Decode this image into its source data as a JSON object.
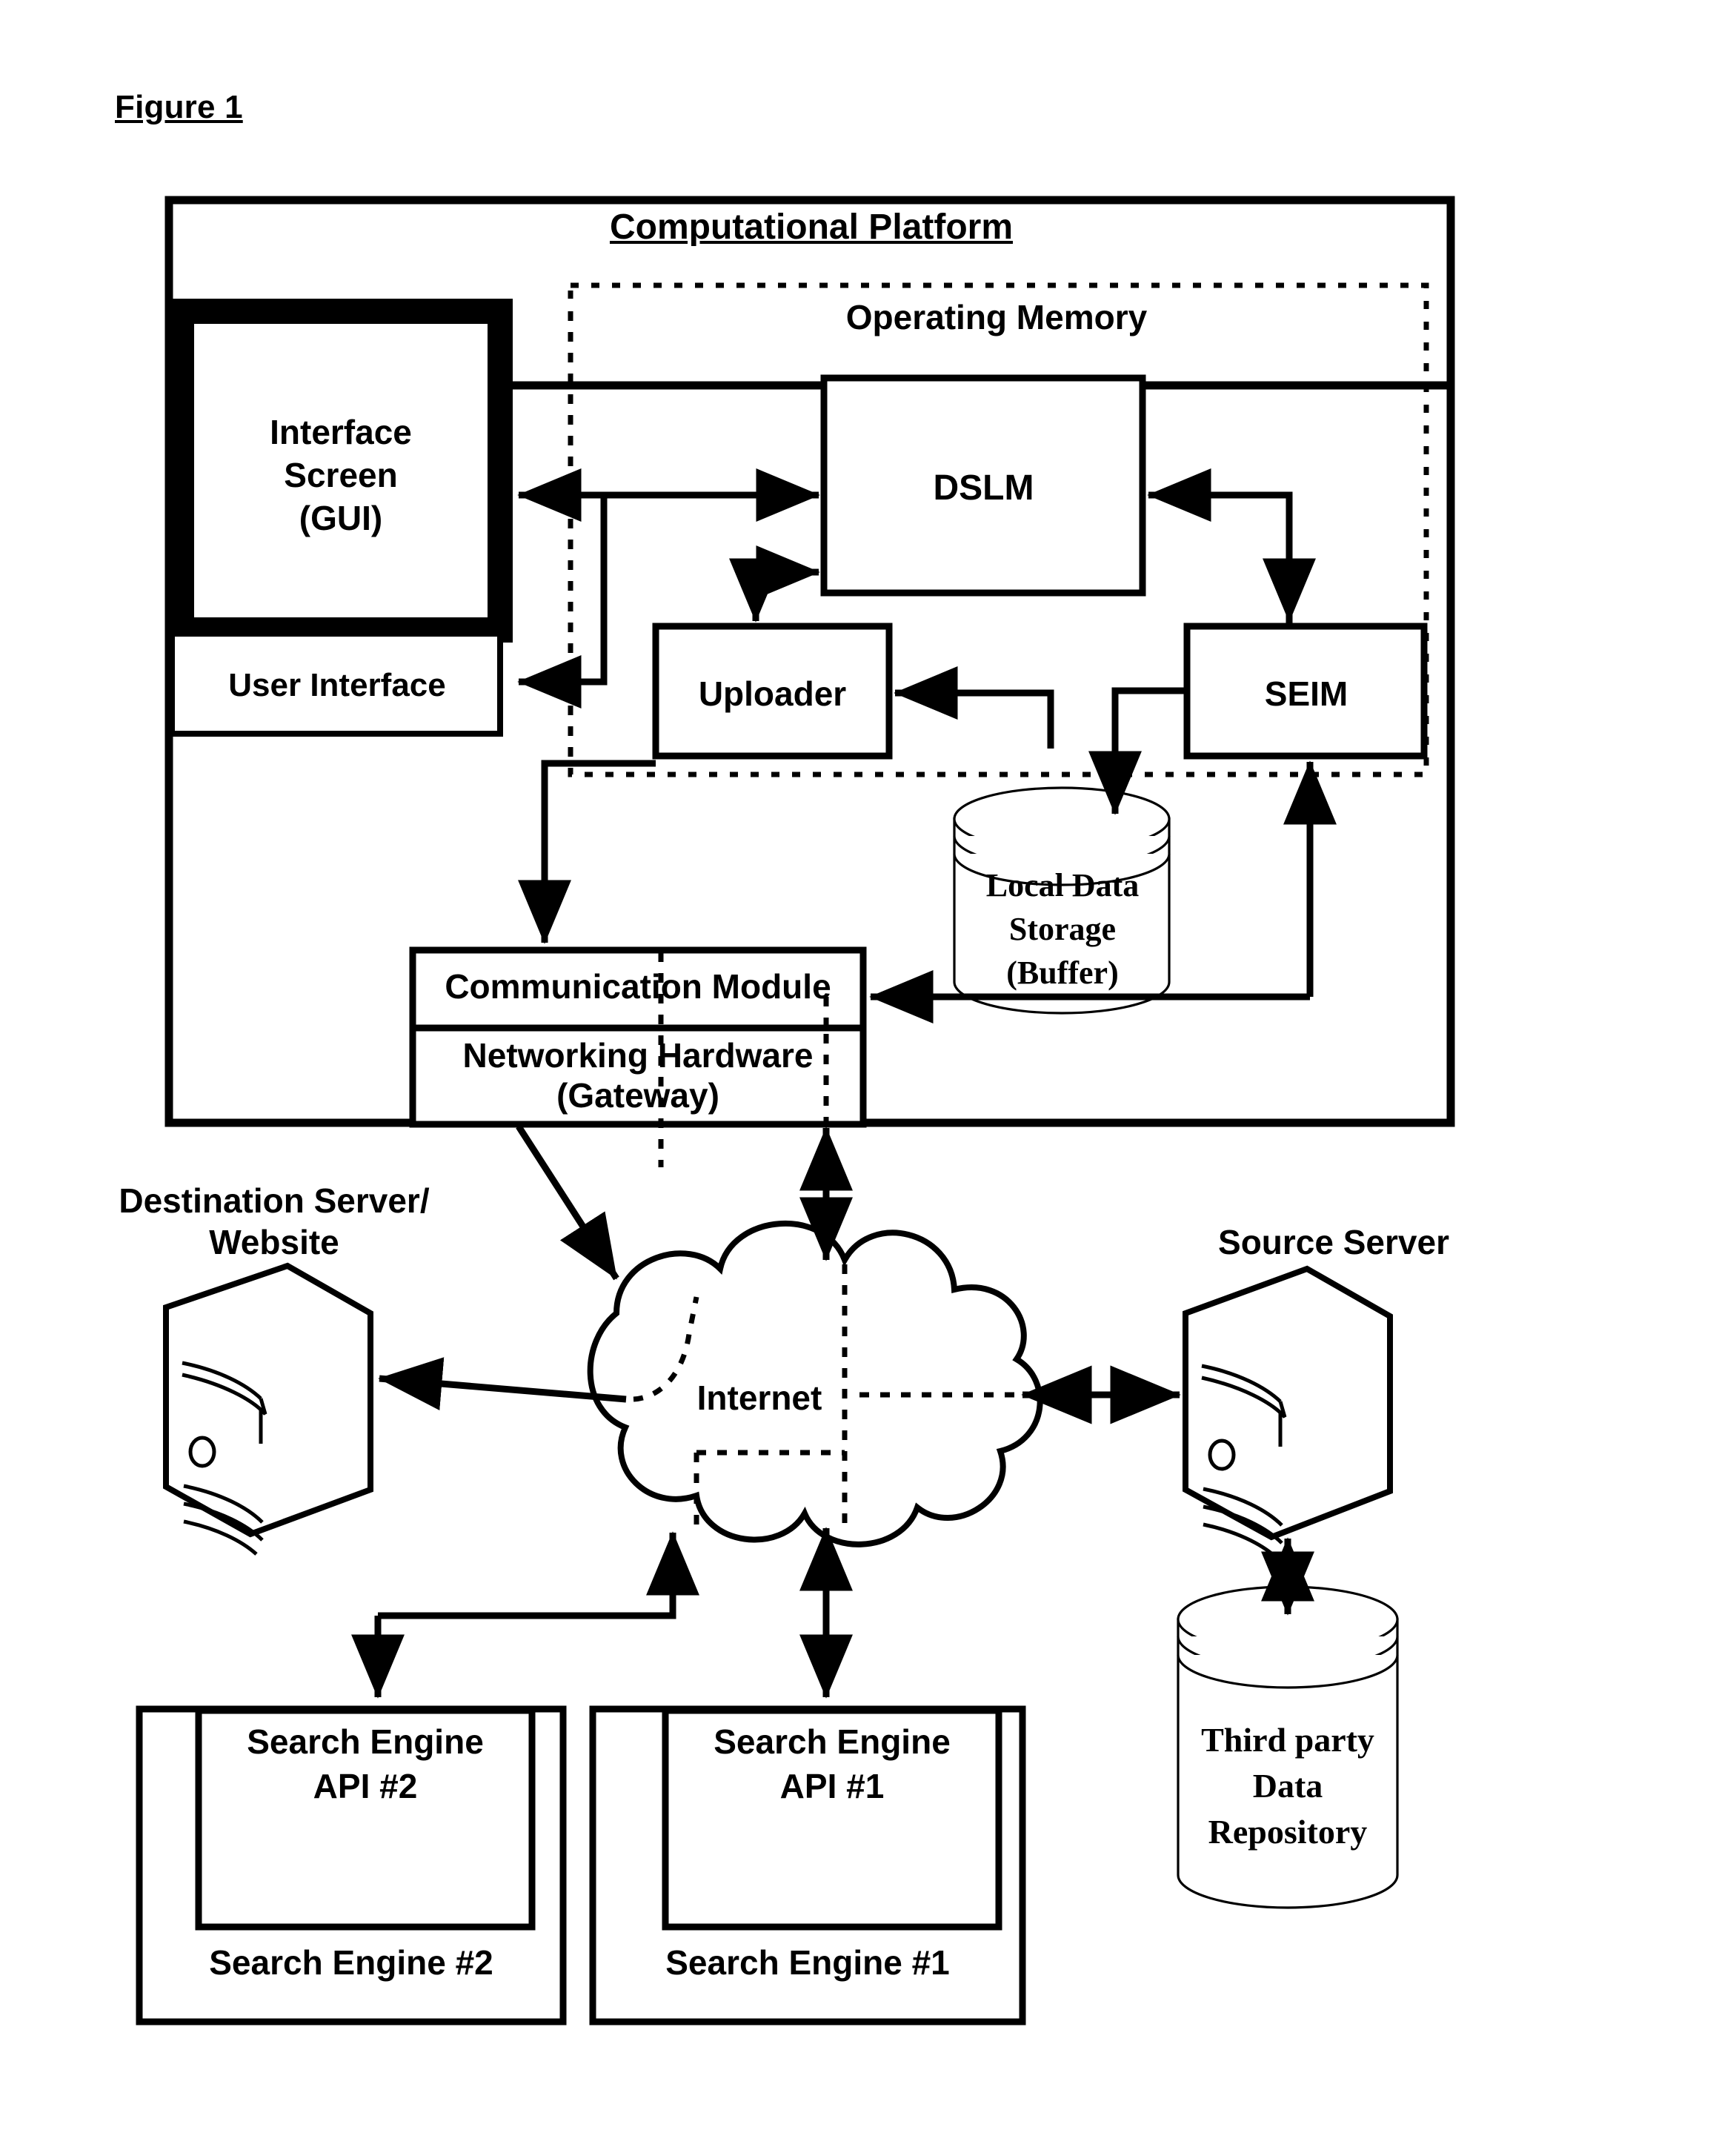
{
  "figure": {
    "label": "Figure 1"
  },
  "platform": {
    "title": "Computational Platform",
    "operating_memory": {
      "title": "Operating Memory"
    },
    "modules": {
      "dslm": "DSLM",
      "uploader": "Uploader",
      "seim": "SEIM"
    },
    "interface": {
      "screen": "Interface\nScreen\n(GUI)",
      "screen_line1": "Interface",
      "screen_line2": "Screen",
      "screen_line3": "(GUI)",
      "user_interface": "User Interface"
    },
    "local_storage": {
      "line1": "Local Data",
      "line2": "Storage",
      "line3": "(Buffer)"
    },
    "communication": {
      "module": "Communication Module",
      "hardware_line1": "Networking Hardware",
      "hardware_line2": "(Gateway)"
    }
  },
  "network": {
    "cloud": "Internet",
    "destination_server_line1": "Destination Server/",
    "destination_server_line2": "Website",
    "source_server": "Source Server"
  },
  "search_engines": [
    {
      "api": "Search Engine\nAPI #2",
      "api_line1": "Search Engine",
      "api_line2": "API #2",
      "name": "Search Engine #2"
    },
    {
      "api": "Search Engine\nAPI #1",
      "api_line1": "Search Engine",
      "api_line2": "API #1",
      "name": "Search Engine #1"
    }
  ],
  "third_party": {
    "line1": "Third party",
    "line2": "Data",
    "line3": "Repository"
  },
  "colors": {
    "stroke": "#000000",
    "fill": "#ffffff"
  }
}
